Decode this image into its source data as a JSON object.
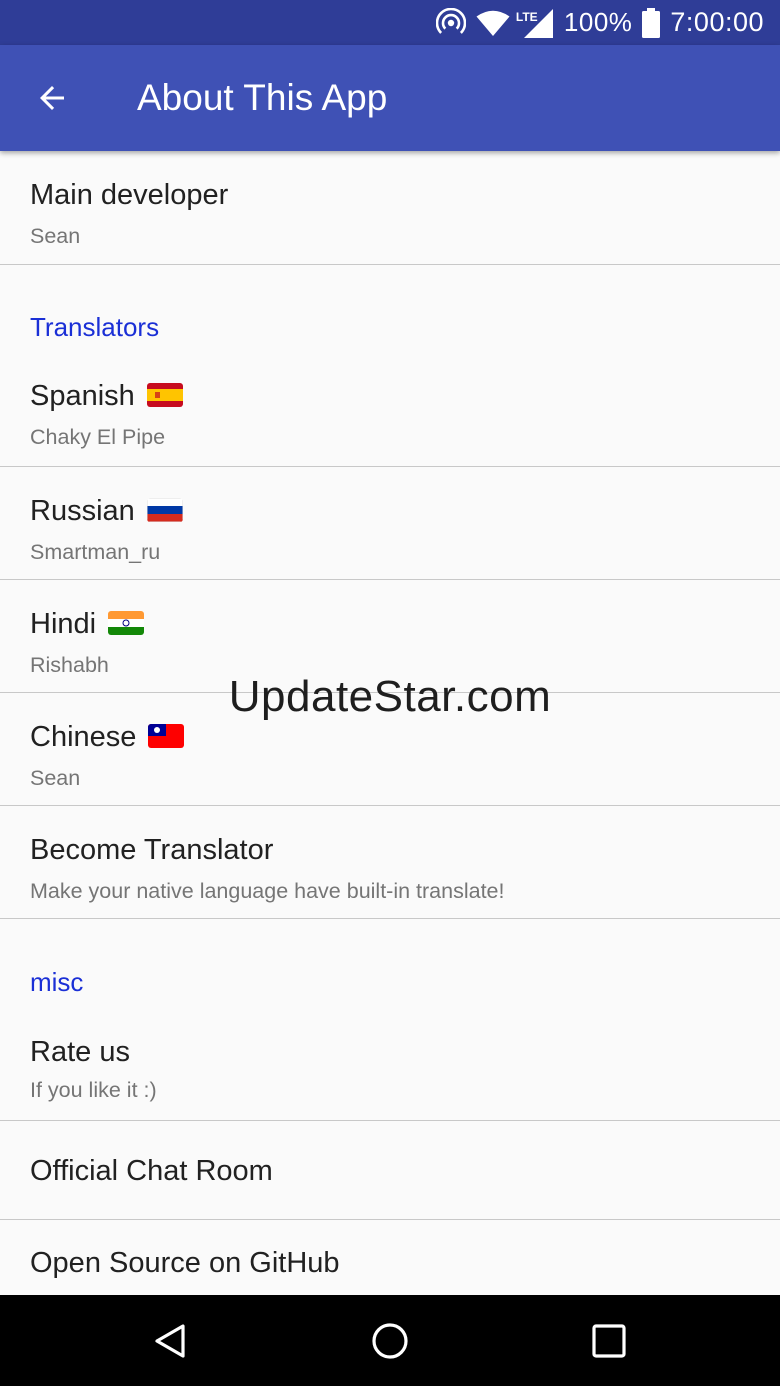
{
  "status_bar": {
    "icons": [
      "hotspot-icon",
      "wifi-icon",
      "lte-signal-icon",
      "battery-icon"
    ],
    "network_label": "LTE",
    "battery": "100%",
    "time": "7:00:00"
  },
  "app_bar": {
    "back_icon": "arrow-back-icon",
    "title": "About This App",
    "color": "#3f51b5",
    "status_color": "#2f3d97"
  },
  "main_developer": {
    "title": "Main developer",
    "summary": "Sean"
  },
  "translators": {
    "category_title": "Translators",
    "items": [
      {
        "title": "Spanish",
        "flag": "flag-spain-icon",
        "summary": "Chaky El Pipe"
      },
      {
        "title": "Russian",
        "flag": "flag-russia-icon",
        "summary": "Smartman_ru"
      },
      {
        "title": "Hindi",
        "flag": "flag-india-icon",
        "summary": "Rishabh"
      },
      {
        "title": "Chinese",
        "flag": "flag-taiwan-icon",
        "summary": "Sean"
      }
    ],
    "become": {
      "title": "Become Translator",
      "summary": "Make your native language have built-in translate!"
    }
  },
  "misc": {
    "category_title": "misc",
    "rate": {
      "title": "Rate us",
      "summary": "If you like it :)"
    },
    "chat": {
      "title": "Official Chat Room"
    },
    "github": {
      "title": "Open Source on GitHub"
    }
  },
  "watermark": "UpdateStar.com",
  "nav_bar": {
    "icons": [
      "back-triangle-icon",
      "home-circle-icon",
      "recents-square-icon"
    ]
  },
  "colors": {
    "accent": "#1a2fd6",
    "title_text": "#212121",
    "summary_text": "#757575",
    "divider": "#c8c8c8"
  }
}
